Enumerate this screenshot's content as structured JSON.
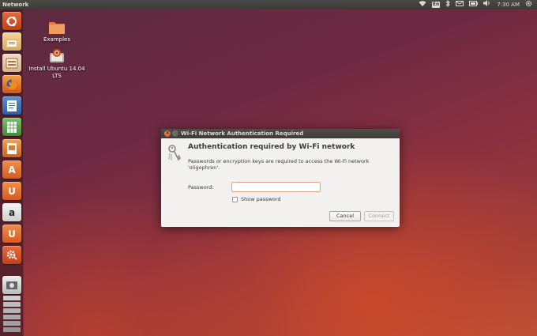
{
  "top_panel": {
    "app_title": "Network",
    "keyboard_indicator": "En",
    "clock": "7:30 AM"
  },
  "launcher": {
    "items": [
      {
        "icon": "ubuntu-dash-icon"
      },
      {
        "icon": "files-icon"
      },
      {
        "icon": "file-manager-icon"
      },
      {
        "icon": "firefox-icon"
      },
      {
        "icon": "libreoffice-writer-icon"
      },
      {
        "icon": "libreoffice-calc-icon"
      },
      {
        "icon": "libreoffice-impress-icon"
      },
      {
        "icon": "software-center-icon",
        "glyph": "A"
      },
      {
        "icon": "ubuntu-one-icon",
        "glyph": "U"
      },
      {
        "icon": "amazon-icon",
        "glyph": "a"
      },
      {
        "icon": "ubuntu-one-music-icon",
        "glyph": "U"
      },
      {
        "icon": "system-settings-icon"
      },
      {
        "icon": "installer-icon"
      }
    ]
  },
  "desktop": {
    "icons": [
      {
        "label": "Examples"
      },
      {
        "label": "Install Ubuntu 14.04 LTS"
      }
    ]
  },
  "dialog": {
    "title": "Wi-Fi Network Authentication Required",
    "heading": "Authentication required by Wi-Fi network",
    "message": "Passwords or encryption keys are required to access the Wi-Fi network 'oligophren'.",
    "password_label": "Password:",
    "password_value": "",
    "show_password_label": "Show password",
    "cancel_label": "Cancel",
    "connect_label": "Connect"
  },
  "colors": {
    "accent": "#e95420",
    "panel": "#3c3b37",
    "dialog_bg": "#f2f1f0"
  }
}
